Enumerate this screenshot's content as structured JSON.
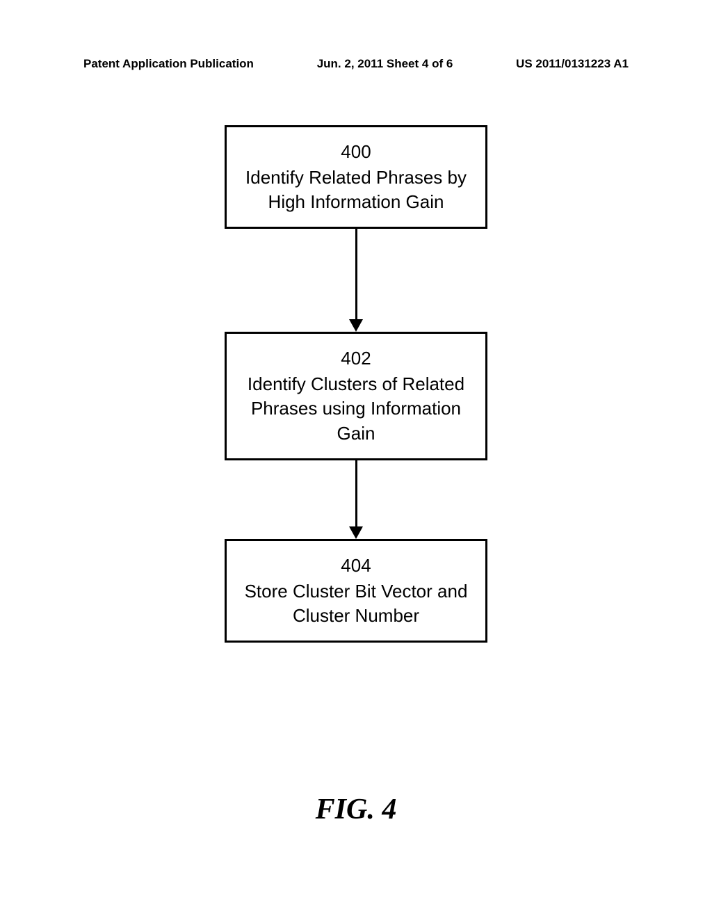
{
  "header": {
    "left": "Patent Application Publication",
    "center": "Jun. 2, 2011  Sheet 4 of 6",
    "right": "US 2011/0131223 A1"
  },
  "boxes": [
    {
      "number": "400",
      "text": "Identify Related Phrases by High Information Gain"
    },
    {
      "number": "402",
      "text": "Identify Clusters of Related Phrases using Information Gain"
    },
    {
      "number": "404",
      "text": "Store Cluster Bit Vector and Cluster Number"
    }
  ],
  "figure_label": "FIG. 4"
}
